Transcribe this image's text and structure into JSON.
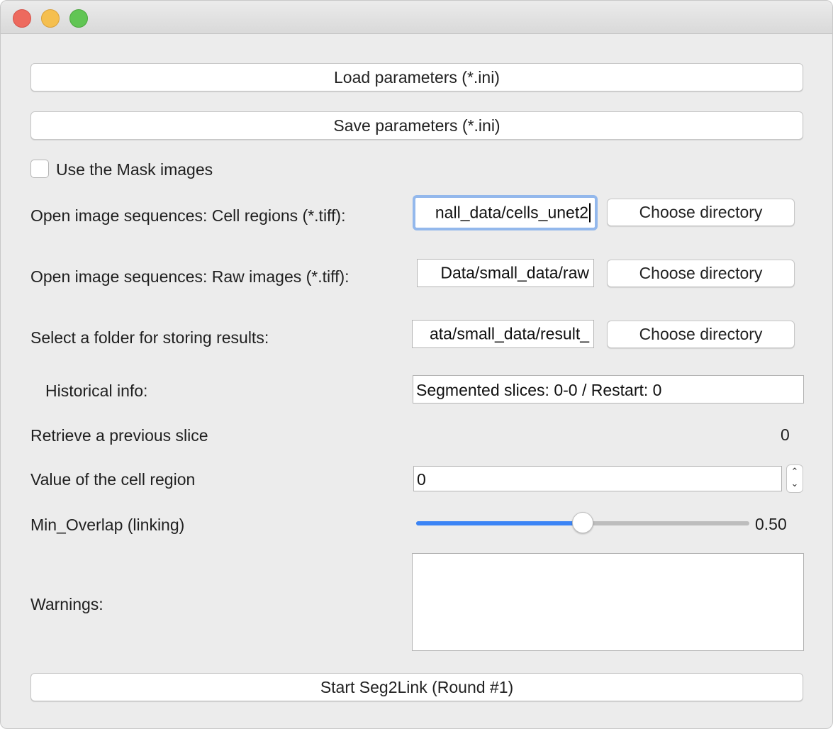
{
  "window": {
    "controls": {
      "close_color": "#ed6a5e",
      "minimize_color": "#f5bf4f",
      "zoom_color": "#61c554"
    }
  },
  "buttons": {
    "load": "Load parameters (*.ini)",
    "save": "Save parameters (*.ini)",
    "start": "Start Seg2Link (Round #1)",
    "choose": "Choose directory"
  },
  "mask_checkbox": {
    "label": "Use the Mask images",
    "checked": false
  },
  "paths": [
    {
      "label": "Open image sequences: Cell regions (*.tiff):",
      "value": "nall_data/cells_unet2",
      "focused": true
    },
    {
      "label": "Open image sequences: Raw images (*.tiff):",
      "value": "Data/small_data/raw",
      "focused": false
    },
    {
      "label": "Select a folder for storing results:",
      "value": "ata/small_data/result_",
      "focused": false
    }
  ],
  "historical": {
    "label": "Historical info:",
    "value": "Segmented slices: 0-0 / Restart: 0"
  },
  "retrieve": {
    "label": "Retrieve a previous slice",
    "value": "0"
  },
  "cell_value": {
    "label": "Value of the cell region",
    "value": "0"
  },
  "min_overlap": {
    "label": "Min_Overlap (linking)",
    "value": 0.5,
    "display": "0.50",
    "accent": "#3b84f5"
  },
  "warnings": {
    "label": "Warnings:",
    "value": ""
  }
}
